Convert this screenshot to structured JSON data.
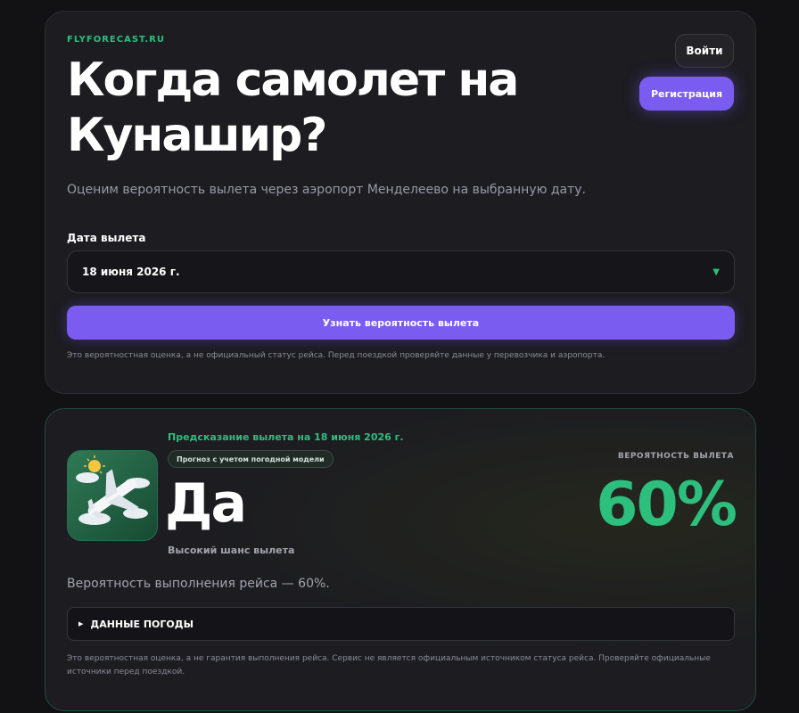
{
  "header": {
    "brand": "FLYFORECAST.RU",
    "login_label": "Войти",
    "register_label": "Регистрация"
  },
  "hero": {
    "title": "Когда самолет на Кунашир?",
    "subtitle": "Оценим вероятность вылета через аэропорт Менделеево на выбранную дату."
  },
  "form": {
    "date_label": "Дата вылета",
    "date_value": "18 июня 2026 г.",
    "submit_label": "Узнать вероятность вылета",
    "note": "Это вероятностная оценка, а не официальный статус рейса. Перед поездкой проверяйте данные у перевозчика и аэропорта."
  },
  "result": {
    "prediction_title": "Предсказание вылета на 18 июня 2026 г.",
    "badge": "Прогноз с учетом погодной модели",
    "answer": "Да",
    "answer_sub": "Высокий шанс вылета",
    "probability_label": "ВЕРОЯТНОСТЬ ВЫЛЕТА",
    "probability_value": "60%",
    "summary": "Вероятность выполнения рейса — 60%.",
    "weather_toggle": "ДАННЫЕ ПОГОДЫ",
    "disclaimer": "Это вероятностная оценка, а не гарантия выполнения рейса. Сервис не является официальным источником статуса рейса. Проверяйте официальные источники перед поездкой.",
    "icon": "airplane-clouds-sun-icon"
  },
  "colors": {
    "background": "#121215",
    "card": "#1c1c21",
    "accent_green": "#2cbf7e",
    "accent_purple": "#7b5cf0"
  }
}
